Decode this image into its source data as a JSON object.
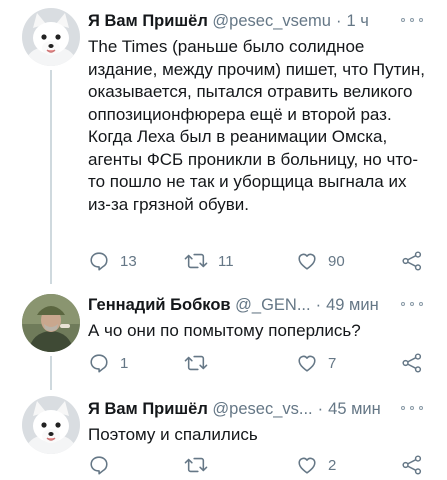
{
  "tweets": [
    {
      "name": "Я Вам Пришёл",
      "handle": "@pesec_vsemu",
      "dot": "·",
      "time": "1 ч",
      "text": "The Times (раньше было солидное издание, между прочим) пишет, что Путин, оказывается, пытался отравить великого оппозиционфюрера ещё и второй раз. Когда Леха был в реанимации Омска, агенты ФСБ проникли в больницу, но что-то пошло не так и уборщица выгнала их из-за грязной обуви.",
      "replies": "13",
      "retweets": "11",
      "likes": "90",
      "avatar": "white-fox-icon"
    },
    {
      "name": "Геннадий Бобков",
      "handle": "@_GEN...",
      "dot": "·",
      "time": "49 мин",
      "text": "А чо они по помытому поперлись?",
      "replies": "1",
      "retweets": "",
      "likes": "7",
      "avatar": "man-in-cap-icon"
    },
    {
      "name": "Я Вам Пришёл",
      "handle": "@pesec_vs...",
      "dot": "·",
      "time": "45 мин",
      "text": "Поэтому и спалились",
      "replies": "",
      "retweets": "",
      "likes": "2",
      "avatar": "white-fox-icon"
    }
  ],
  "colors": {
    "text": "#14171a",
    "secondary": "#657786",
    "thread_line": "#cfd9de"
  }
}
